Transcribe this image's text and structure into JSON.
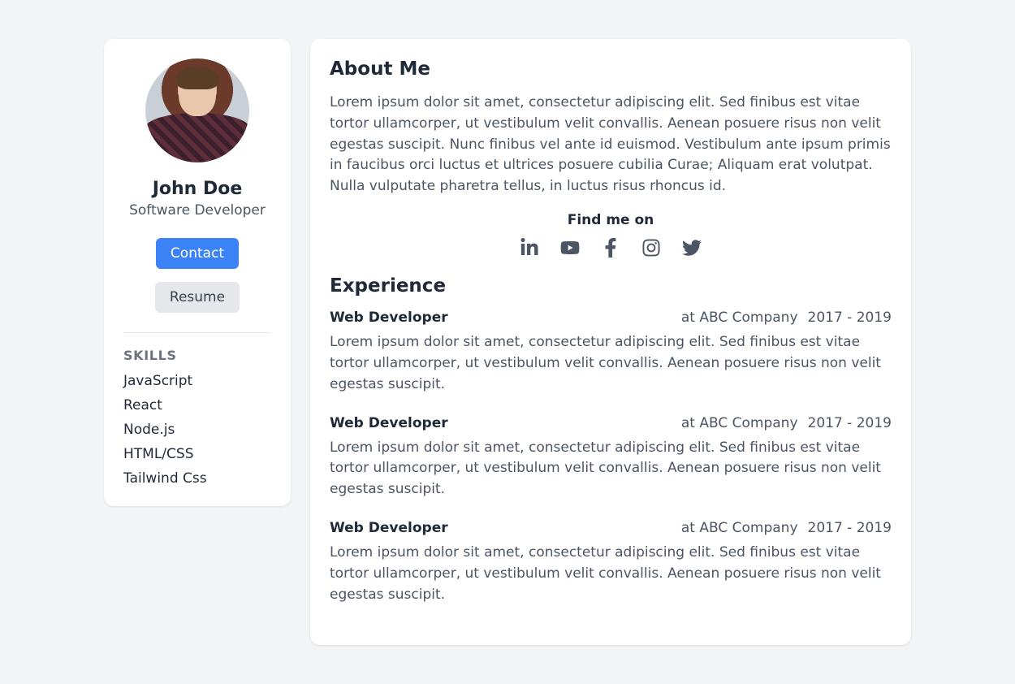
{
  "sidebar": {
    "name": "John Doe",
    "title": "Software Developer",
    "contact_label": "Contact",
    "resume_label": "Resume",
    "skills_heading": "SKILLS",
    "skills": [
      "JavaScript",
      "React",
      "Node.js",
      "HTML/CSS",
      "Tailwind Css"
    ]
  },
  "main": {
    "about_heading": "About Me",
    "about_text": "Lorem ipsum dolor sit amet, consectetur adipiscing elit. Sed finibus est vitae tortor ullamcorper, ut vestibulum velit convallis. Aenean posuere risus non velit egestas suscipit. Nunc finibus vel ante id euismod. Vestibulum ante ipsum primis in faucibus orci luctus et ultrices posuere cubilia Curae; Aliquam erat volutpat. Nulla vulputate pharetra tellus, in luctus risus rhoncus id.",
    "find_me_heading": "Find me on",
    "social": [
      {
        "name": "linkedin"
      },
      {
        "name": "youtube"
      },
      {
        "name": "facebook"
      },
      {
        "name": "instagram"
      },
      {
        "name": "twitter"
      }
    ],
    "experience_heading": "Experience",
    "experience": [
      {
        "role": "Web Developer",
        "company": "at ABC Company",
        "dates": "2017 - 2019",
        "desc": "Lorem ipsum dolor sit amet, consectetur adipiscing elit. Sed finibus est vitae tortor ullamcorper, ut vestibulum velit convallis. Aenean posuere risus non velit egestas suscipit."
      },
      {
        "role": "Web Developer",
        "company": "at ABC Company",
        "dates": "2017 - 2019",
        "desc": "Lorem ipsum dolor sit amet, consectetur adipiscing elit. Sed finibus est vitae tortor ullamcorper, ut vestibulum velit convallis. Aenean posuere risus non velit egestas suscipit."
      },
      {
        "role": "Web Developer",
        "company": "at ABC Company",
        "dates": "2017 - 2019",
        "desc": "Lorem ipsum dolor sit amet, consectetur adipiscing elit. Sed finibus est vitae tortor ullamcorper, ut vestibulum velit convallis. Aenean posuere risus non velit egestas suscipit."
      }
    ]
  }
}
